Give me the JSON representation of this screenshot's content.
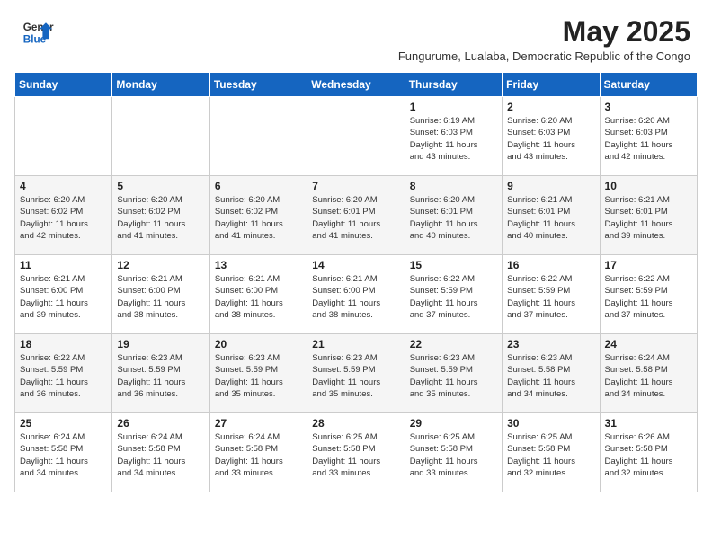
{
  "header": {
    "logo_general": "General",
    "logo_blue": "Blue",
    "month_title": "May 2025",
    "subtitle": "Fungurume, Lualaba, Democratic Republic of the Congo"
  },
  "days_of_week": [
    "Sunday",
    "Monday",
    "Tuesday",
    "Wednesday",
    "Thursday",
    "Friday",
    "Saturday"
  ],
  "weeks": [
    [
      {
        "day": "",
        "info": ""
      },
      {
        "day": "",
        "info": ""
      },
      {
        "day": "",
        "info": ""
      },
      {
        "day": "",
        "info": ""
      },
      {
        "day": "1",
        "info": "Sunrise: 6:19 AM\nSunset: 6:03 PM\nDaylight: 11 hours\nand 43 minutes."
      },
      {
        "day": "2",
        "info": "Sunrise: 6:20 AM\nSunset: 6:03 PM\nDaylight: 11 hours\nand 43 minutes."
      },
      {
        "day": "3",
        "info": "Sunrise: 6:20 AM\nSunset: 6:03 PM\nDaylight: 11 hours\nand 42 minutes."
      }
    ],
    [
      {
        "day": "4",
        "info": "Sunrise: 6:20 AM\nSunset: 6:02 PM\nDaylight: 11 hours\nand 42 minutes."
      },
      {
        "day": "5",
        "info": "Sunrise: 6:20 AM\nSunset: 6:02 PM\nDaylight: 11 hours\nand 41 minutes."
      },
      {
        "day": "6",
        "info": "Sunrise: 6:20 AM\nSunset: 6:02 PM\nDaylight: 11 hours\nand 41 minutes."
      },
      {
        "day": "7",
        "info": "Sunrise: 6:20 AM\nSunset: 6:01 PM\nDaylight: 11 hours\nand 41 minutes."
      },
      {
        "day": "8",
        "info": "Sunrise: 6:20 AM\nSunset: 6:01 PM\nDaylight: 11 hours\nand 40 minutes."
      },
      {
        "day": "9",
        "info": "Sunrise: 6:21 AM\nSunset: 6:01 PM\nDaylight: 11 hours\nand 40 minutes."
      },
      {
        "day": "10",
        "info": "Sunrise: 6:21 AM\nSunset: 6:01 PM\nDaylight: 11 hours\nand 39 minutes."
      }
    ],
    [
      {
        "day": "11",
        "info": "Sunrise: 6:21 AM\nSunset: 6:00 PM\nDaylight: 11 hours\nand 39 minutes."
      },
      {
        "day": "12",
        "info": "Sunrise: 6:21 AM\nSunset: 6:00 PM\nDaylight: 11 hours\nand 38 minutes."
      },
      {
        "day": "13",
        "info": "Sunrise: 6:21 AM\nSunset: 6:00 PM\nDaylight: 11 hours\nand 38 minutes."
      },
      {
        "day": "14",
        "info": "Sunrise: 6:21 AM\nSunset: 6:00 PM\nDaylight: 11 hours\nand 38 minutes."
      },
      {
        "day": "15",
        "info": "Sunrise: 6:22 AM\nSunset: 5:59 PM\nDaylight: 11 hours\nand 37 minutes."
      },
      {
        "day": "16",
        "info": "Sunrise: 6:22 AM\nSunset: 5:59 PM\nDaylight: 11 hours\nand 37 minutes."
      },
      {
        "day": "17",
        "info": "Sunrise: 6:22 AM\nSunset: 5:59 PM\nDaylight: 11 hours\nand 37 minutes."
      }
    ],
    [
      {
        "day": "18",
        "info": "Sunrise: 6:22 AM\nSunset: 5:59 PM\nDaylight: 11 hours\nand 36 minutes."
      },
      {
        "day": "19",
        "info": "Sunrise: 6:23 AM\nSunset: 5:59 PM\nDaylight: 11 hours\nand 36 minutes."
      },
      {
        "day": "20",
        "info": "Sunrise: 6:23 AM\nSunset: 5:59 PM\nDaylight: 11 hours\nand 35 minutes."
      },
      {
        "day": "21",
        "info": "Sunrise: 6:23 AM\nSunset: 5:59 PM\nDaylight: 11 hours\nand 35 minutes."
      },
      {
        "day": "22",
        "info": "Sunrise: 6:23 AM\nSunset: 5:59 PM\nDaylight: 11 hours\nand 35 minutes."
      },
      {
        "day": "23",
        "info": "Sunrise: 6:23 AM\nSunset: 5:58 PM\nDaylight: 11 hours\nand 34 minutes."
      },
      {
        "day": "24",
        "info": "Sunrise: 6:24 AM\nSunset: 5:58 PM\nDaylight: 11 hours\nand 34 minutes."
      }
    ],
    [
      {
        "day": "25",
        "info": "Sunrise: 6:24 AM\nSunset: 5:58 PM\nDaylight: 11 hours\nand 34 minutes."
      },
      {
        "day": "26",
        "info": "Sunrise: 6:24 AM\nSunset: 5:58 PM\nDaylight: 11 hours\nand 34 minutes."
      },
      {
        "day": "27",
        "info": "Sunrise: 6:24 AM\nSunset: 5:58 PM\nDaylight: 11 hours\nand 33 minutes."
      },
      {
        "day": "28",
        "info": "Sunrise: 6:25 AM\nSunset: 5:58 PM\nDaylight: 11 hours\nand 33 minutes."
      },
      {
        "day": "29",
        "info": "Sunrise: 6:25 AM\nSunset: 5:58 PM\nDaylight: 11 hours\nand 33 minutes."
      },
      {
        "day": "30",
        "info": "Sunrise: 6:25 AM\nSunset: 5:58 PM\nDaylight: 11 hours\nand 32 minutes."
      },
      {
        "day": "31",
        "info": "Sunrise: 6:26 AM\nSunset: 5:58 PM\nDaylight: 11 hours\nand 32 minutes."
      }
    ]
  ]
}
